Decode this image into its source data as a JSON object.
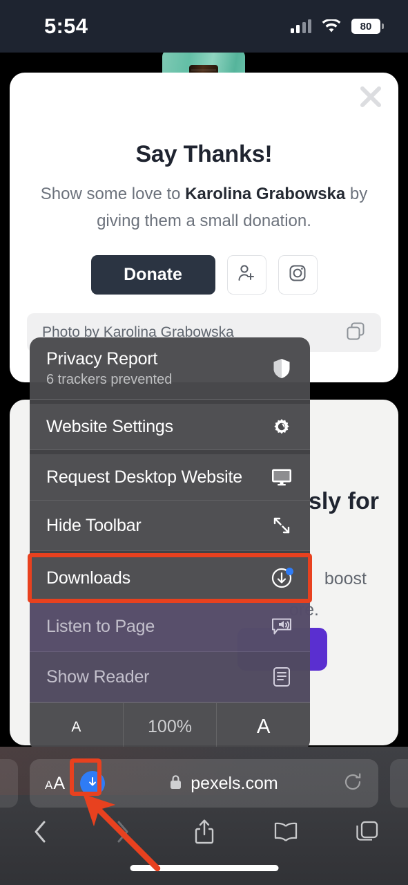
{
  "status_bar": {
    "time": "5:54",
    "battery_percent": "80",
    "signal_icon": "cellular-bars-icon",
    "wifi_icon": "wifi-icon",
    "battery_icon": "battery-icon"
  },
  "donation_modal": {
    "close_icon": "close-icon",
    "thumbnail": "photo-thumbnail",
    "title": "Say Thanks!",
    "subtitle_before": "Show some love to ",
    "subtitle_author": "Karolina Grabowska",
    "subtitle_after": " by giving them a small donation.",
    "donate_label": "Donate",
    "follow_icon": "add-person-icon",
    "instagram_icon": "instagram-icon",
    "attribution_text": "Photo by Karolina Grabowska",
    "copy_icon": "copy-icon"
  },
  "background_card": {
    "heading_fragment": "sly for",
    "line1_fragment": "boost",
    "line2_fragment": "ore.",
    "button": "purple-cta-button"
  },
  "context_menu": {
    "items": [
      {
        "label": "Privacy Report",
        "sublabel": "6 trackers prevented",
        "icon": "shield-icon",
        "state": "enabled"
      },
      {
        "label": "Website Settings",
        "sublabel": "",
        "icon": "gear-icon",
        "state": "enabled"
      },
      {
        "label": "Request Desktop Website",
        "sublabel": "",
        "icon": "desktop-monitor-icon",
        "state": "enabled"
      },
      {
        "label": "Hide Toolbar",
        "sublabel": "",
        "icon": "expand-arrows-icon",
        "state": "enabled"
      },
      {
        "label": "Downloads",
        "sublabel": "",
        "icon": "download-circle-icon",
        "state": "enabled",
        "badge": "new-download-dot"
      },
      {
        "label": "Listen to Page",
        "sublabel": "",
        "icon": "speaker-bubble-icon",
        "state": "disabled"
      },
      {
        "label": "Show Reader",
        "sublabel": "",
        "icon": "reader-document-icon",
        "state": "disabled"
      }
    ],
    "zoom_row": {
      "decrease_label": "A",
      "value": "100%",
      "increase_label": "A"
    }
  },
  "browser_chrome": {
    "text_size_label_small": "A",
    "text_size_label_large": "A",
    "download_indicator_icon": "download-arrow-icon",
    "lock_icon": "lock-icon",
    "url": "pexels.com",
    "reload_icon": "reload-icon",
    "nav": {
      "back_icon": "chevron-left-icon",
      "forward_icon": "chevron-right-icon",
      "share_icon": "share-icon",
      "bookmarks_icon": "book-icon",
      "tabs_icon": "tabs-icon"
    }
  },
  "annotations": {
    "highlight_color": "#e8411f",
    "downloads_menu_box": "downloads-menu-highlight",
    "download_button_box": "download-button-highlight",
    "arrow": "pointer-arrow"
  }
}
